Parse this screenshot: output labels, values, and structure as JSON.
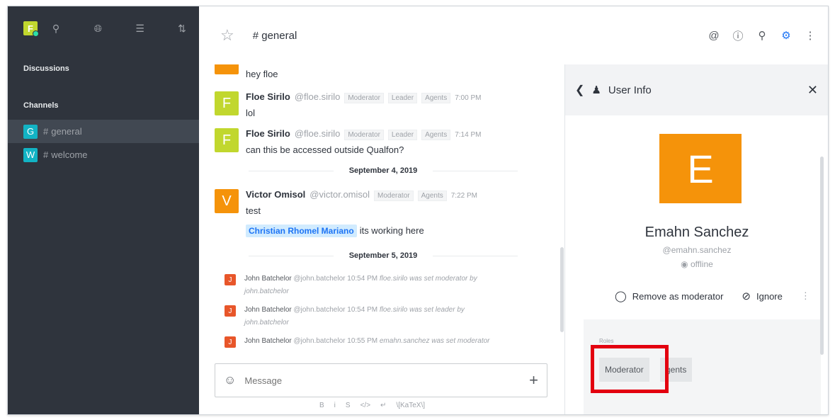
{
  "sidebar": {
    "user_initial": "F",
    "discussions_label": "Discussions",
    "channels_label": "Channels",
    "channels": [
      {
        "initial": "G",
        "name": "general",
        "active": true
      },
      {
        "initial": "W",
        "name": "welcome",
        "active": false
      }
    ],
    "icons": [
      "search-icon",
      "globe-icon",
      "list-icon",
      "sort-icon"
    ]
  },
  "header": {
    "room": "# general",
    "actions": [
      "mention-icon",
      "info-icon",
      "search-icon",
      "members-icon",
      "kebab-icon"
    ]
  },
  "messages": [
    {
      "text": "hey floe",
      "avatar_color": "#f5930a"
    },
    {
      "initial": "F",
      "avatar_color": "#c1d72e",
      "name": "Floe Sirilo",
      "handle": "@floe.sirilo",
      "roles": [
        "Moderator",
        "Leader",
        "Agents"
      ],
      "time": "7:00 PM",
      "text": "lol"
    },
    {
      "initial": "F",
      "avatar_color": "#c1d72e",
      "name": "Floe Sirilo",
      "handle": "@floe.sirilo",
      "roles": [
        "Moderator",
        "Leader",
        "Agents"
      ],
      "time": "7:14 PM",
      "text": "can this be accessed outside Qualfon?"
    },
    {
      "date": "September 4, 2019"
    },
    {
      "initial": "V",
      "avatar_color": "#f5930a",
      "name": "Victor Omisol",
      "handle": "@victor.omisol",
      "roles": [
        "Moderator",
        "Agents"
      ],
      "time": "7:22 PM",
      "text": "test",
      "mention": "Christian Rhomel Mariano",
      "text2": "its working here"
    },
    {
      "date": "September 5, 2019"
    }
  ],
  "system_messages": [
    {
      "initial": "J",
      "name": "John Batchelor",
      "handle": "@john.batchelor",
      "time": "10:54 PM",
      "text": "floe.sirilo was set moderator by",
      "by": "john.batchelor"
    },
    {
      "initial": "J",
      "name": "John Batchelor",
      "handle": "@john.batchelor",
      "time": "10:54 PM",
      "text": "floe.sirilo was set leader by",
      "by": "john.batchelor"
    },
    {
      "initial": "J",
      "name": "John Batchelor",
      "handle": "@john.batchelor",
      "time": "10:55 PM",
      "text": "emahn.sanchez was set moderator",
      "by": ""
    }
  ],
  "composer": {
    "placeholder": "Message",
    "format_items": [
      "B",
      "i",
      "S",
      "</>",
      "↵",
      "\\[KaTeX\\]"
    ]
  },
  "user_info": {
    "title": "User Info",
    "initial": "E",
    "avatar_color": "#f5930a",
    "name": "Emahn Sanchez",
    "handle": "@emahn.sanchez",
    "status": "offline",
    "remove_moderator": "Remove as moderator",
    "ignore": "Ignore",
    "roles_label": "Roles",
    "roles": [
      "Moderator",
      "gents"
    ],
    "highlight_color": "#e3000f"
  }
}
